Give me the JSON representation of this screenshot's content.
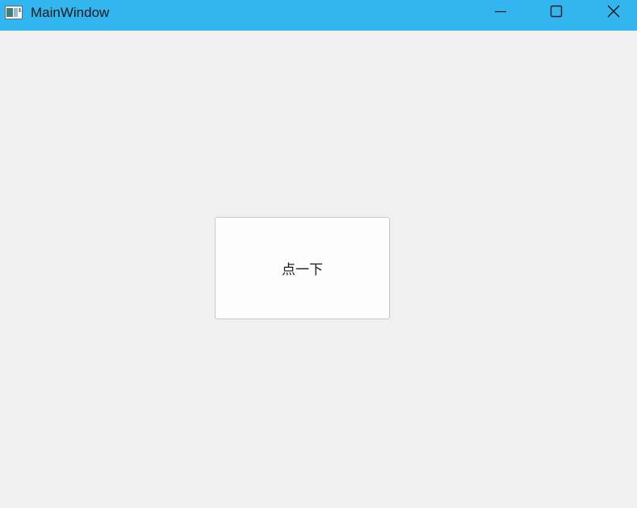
{
  "window": {
    "title": "MainWindow",
    "titlebar_color": "#33b5f0",
    "background_color": "#f0f0f0"
  },
  "icons": {
    "app": "app-window-icon",
    "minimize": "minimize-icon",
    "maximize": "maximize-icon",
    "close": "close-icon"
  },
  "main": {
    "button_label": "点一下"
  }
}
